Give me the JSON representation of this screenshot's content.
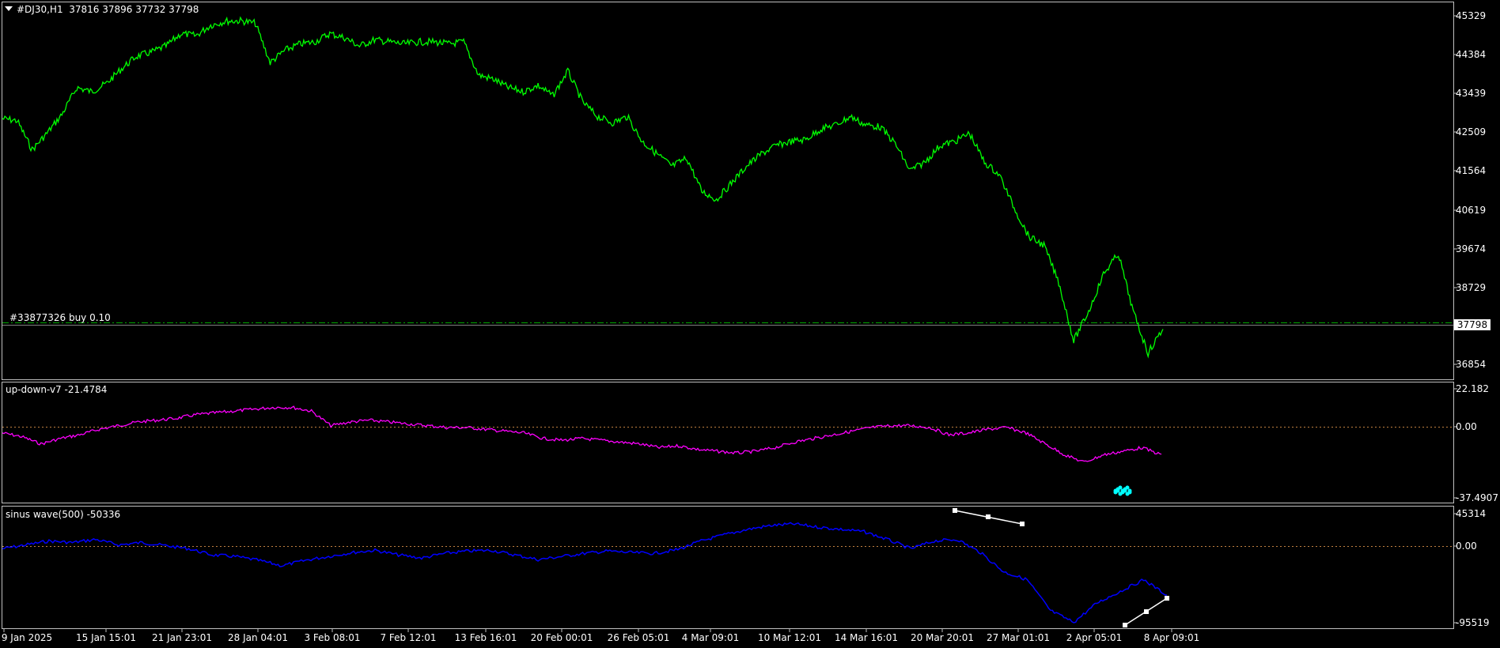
{
  "main": {
    "header_symbol": "#DJ30,H1",
    "header_ohlc": "37816 37896 37732 37798",
    "order_label": "#33877326 buy 0.10",
    "price_box": "37798",
    "scale_labels": [
      "45329",
      "44384",
      "43439",
      "42509",
      "41564",
      "40619",
      "39674",
      "38729",
      "36854"
    ],
    "line_color": "#00ff00"
  },
  "indicator1": {
    "title": "up-down-v7 -21.4784",
    "scale_labels": [
      "22.182",
      "0.00",
      "-37.4907"
    ],
    "line_color": "#ff00ff",
    "marker_color": "#00ffff"
  },
  "indicator2": {
    "title": "sinus wave(500) -50336",
    "scale_labels": [
      "45314",
      "0.00",
      "-95519"
    ],
    "line_color": "#0000ff"
  },
  "x_axis": {
    "labels": [
      "9 Jan 2025",
      "15 Jan 15:01",
      "21 Jan 23:01",
      "28 Jan 04:01",
      "3 Feb 08:01",
      "7 Feb 12:01",
      "13 Feb 16:01",
      "20 Feb 00:01",
      "26 Feb 05:01",
      "4 Mar 09:01",
      "10 Mar 12:01",
      "14 Mar 16:01",
      "20 Mar 20:01",
      "27 Mar 01:01",
      "2 Apr 05:01",
      "8 Apr 09:01"
    ]
  },
  "chart_data": {
    "type": "line",
    "title": "#DJ30,H1",
    "series": [
      {
        "name": "#DJ30,H1",
        "values": [
          42850,
          42800,
          42100,
          42500,
          42950,
          43600,
          43500,
          43700,
          44050,
          44350,
          44450,
          44600,
          44900,
          44850,
          45100,
          45200,
          45210,
          45150,
          44200,
          44500,
          44650,
          44700,
          44900,
          44800,
          44600,
          44750,
          44700,
          44650,
          44700,
          44700,
          44650,
          44700,
          43900,
          43800,
          43600,
          43500,
          43650,
          43400,
          44000,
          43250,
          42900,
          42750,
          42900,
          42300,
          42000,
          41700,
          41900,
          41100,
          40900,
          41300,
          41700,
          42000,
          42200,
          42300,
          42350,
          42600,
          42700,
          42900,
          42700,
          42650,
          42250,
          41600,
          41800,
          42200,
          42300,
          42500,
          41800,
          41500,
          40700,
          40000,
          39800,
          38900,
          37500,
          38200,
          39100,
          39600,
          38200,
          37200,
          37800
        ]
      },
      {
        "name": "up-down-v7",
        "values": [
          -2,
          -4,
          -8,
          -5,
          -3,
          0,
          2,
          4,
          5,
          6,
          8,
          9,
          10,
          11,
          12,
          12,
          10,
          2,
          4,
          5,
          4,
          3,
          2,
          1,
          1,
          0,
          -1,
          -2,
          -5,
          -6,
          -5,
          -6,
          -7,
          -8,
          -10,
          -9,
          -11,
          -12,
          -13,
          -12,
          -10,
          -7,
          -5,
          -3,
          -1,
          1,
          2,
          2,
          1,
          -3,
          -2,
          0,
          1,
          -2,
          -8,
          -14,
          -18,
          -14,
          -12,
          -10,
          -14
        ]
      },
      {
        "name": "sinus wave(500)",
        "values": [
          0,
          5000,
          10000,
          8000,
          12000,
          5000,
          8000,
          4000,
          0,
          -8000,
          -10000,
          -15000,
          -22000,
          -15000,
          -10000,
          -5000,
          -2000,
          -8000,
          -12000,
          -6000,
          -3000,
          -2000,
          -8000,
          -14000,
          -10000,
          -6000,
          -3000,
          -5000,
          -6000,
          -1000,
          10000,
          18000,
          25000,
          30000,
          32000,
          28000,
          25000,
          22000,
          12000,
          0,
          10000,
          12000,
          -5000,
          -30000,
          -40000,
          -80000,
          -95000,
          -70000,
          -55000,
          -40000,
          -60000
        ]
      }
    ],
    "main_ylim": [
      36854,
      45329
    ],
    "indicator1_ylim": [
      -37.4907,
      22.182
    ],
    "indicator2_ylim": [
      -95519,
      45314
    ]
  }
}
